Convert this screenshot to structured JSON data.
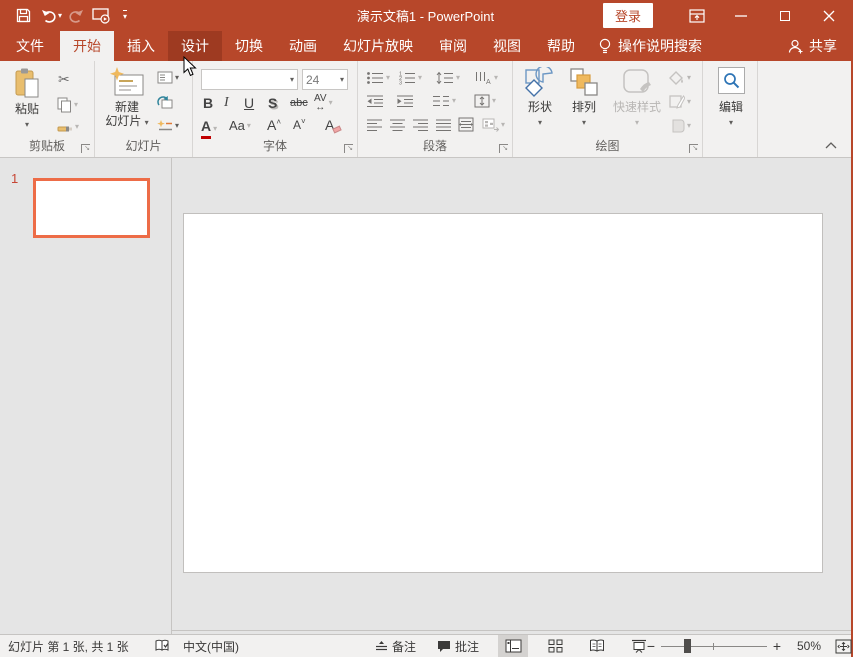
{
  "titlebar": {
    "title": "演示文稿1 - PowerPoint",
    "login": "登录"
  },
  "tabs": {
    "file": "文件",
    "items": [
      {
        "label": "开始"
      },
      {
        "label": "插入"
      },
      {
        "label": "设计"
      },
      {
        "label": "切换"
      },
      {
        "label": "动画"
      },
      {
        "label": "幻灯片放映"
      },
      {
        "label": "审阅"
      },
      {
        "label": "视图"
      },
      {
        "label": "帮助"
      }
    ],
    "tell_me": "操作说明搜索",
    "share": "共享"
  },
  "ribbon": {
    "clipboard": {
      "paste": "粘贴",
      "label": "剪贴板"
    },
    "slides": {
      "new_slide_l1": "新建",
      "new_slide_l2": "幻灯片",
      "label": "幻灯片"
    },
    "font": {
      "size": "24",
      "bold": "B",
      "italic": "I",
      "underline": "U",
      "shadow": "S",
      "strike": "abc",
      "spacing": "AV",
      "color": "A",
      "case": "Aa",
      "grow": "A",
      "shrink": "A",
      "clear": "A",
      "label": "字体"
    },
    "paragraph": {
      "label": "段落"
    },
    "drawing": {
      "shapes": "形状",
      "arrange": "排列",
      "quick_styles": "快速样式",
      "label": "绘图"
    },
    "editing": {
      "label": "编辑"
    }
  },
  "slides_panel": {
    "slide_number": "1"
  },
  "statusbar": {
    "slide_info": "幻灯片 第 1 张, 共 1 张",
    "language": "中文(中国)",
    "notes": "备注",
    "comments": "批注",
    "zoom_minus": "−",
    "zoom_plus": "+",
    "zoom": "50%"
  },
  "colors": {
    "accent": "#B7472A",
    "tab_hover": "#9E3A21",
    "selection": "#ED6C47"
  }
}
